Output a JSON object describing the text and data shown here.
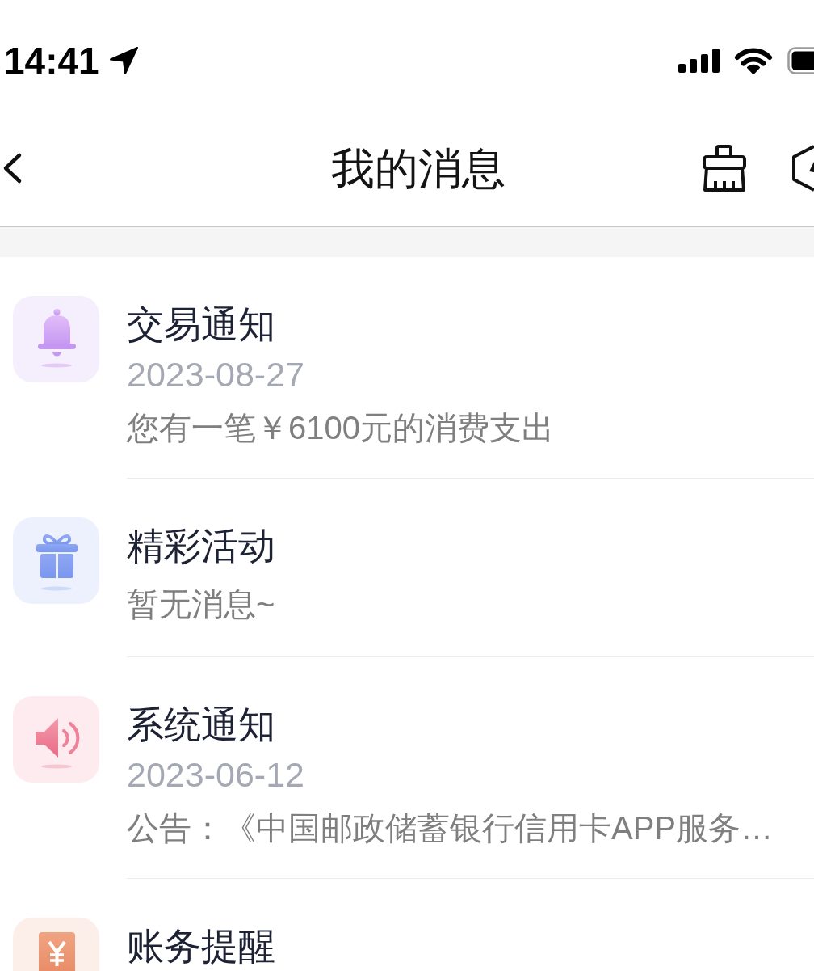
{
  "status_bar": {
    "time": "14:41"
  },
  "nav_bar": {
    "title": "我的消息"
  },
  "messages": [
    {
      "kind": "transaction",
      "title": "交易通知",
      "date": "2023-08-27",
      "preview": "您有一笔￥6100元的消费支出"
    },
    {
      "kind": "activity",
      "title": "精彩活动",
      "preview": "暂无消息~"
    },
    {
      "kind": "system",
      "title": "系统通知",
      "date": "2023-06-12",
      "preview": "公告：《中国邮政储蓄银行信用卡APP服务…"
    },
    {
      "kind": "billing",
      "title": "账务提醒"
    }
  ]
}
